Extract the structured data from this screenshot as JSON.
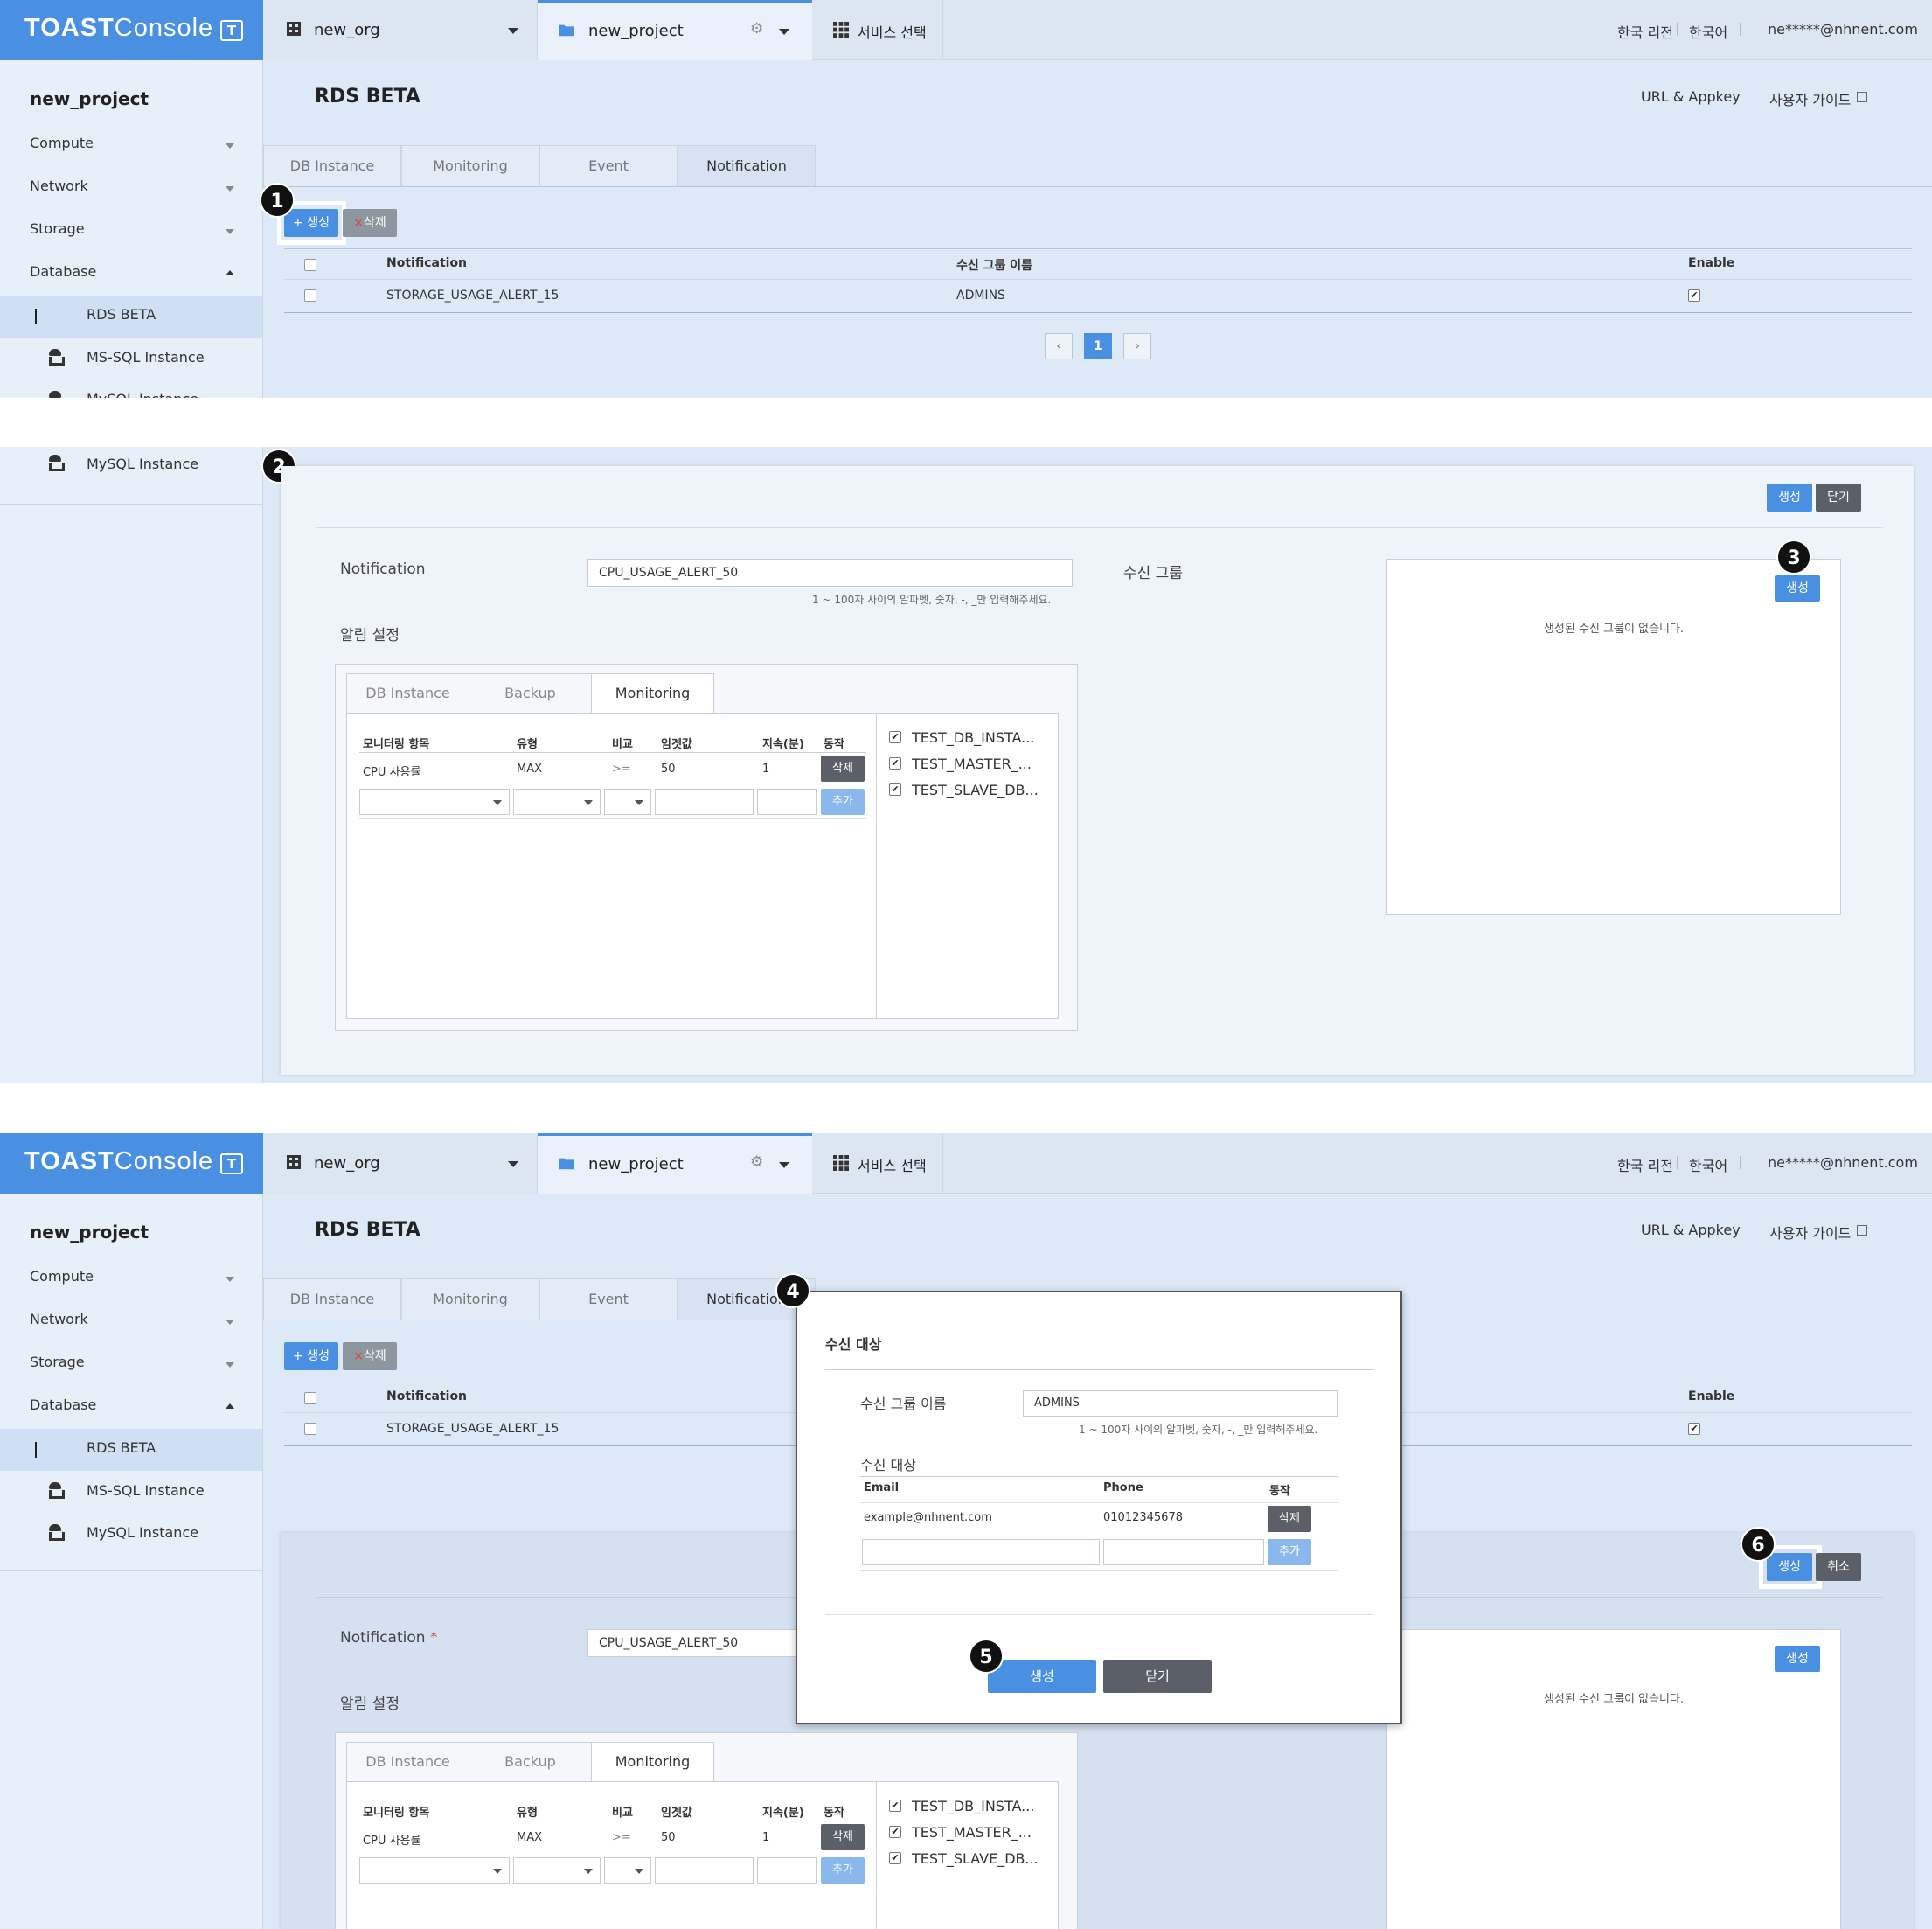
{
  "brand": {
    "name_bold": "TOAST",
    "name_rest": "Console",
    "icon_letter": "T"
  },
  "topbar": {
    "org": "new_org",
    "project": "new_project",
    "service_select": "서비스 선택",
    "region": "한국 리전",
    "language": "한국어",
    "user": "ne*****@nhnent.com"
  },
  "sidebar": {
    "project": "new_project",
    "items": [
      "Compute",
      "Network",
      "Storage",
      "Database"
    ],
    "sub_items": [
      "RDS BETA",
      "MS-SQL Instance",
      "MySQL Instance"
    ]
  },
  "header": {
    "title": "RDS BETA",
    "url_appkey": "URL & Appkey",
    "user_guide": "사용자 가이드"
  },
  "tabs": [
    "DB Instance",
    "Monitoring",
    "Event",
    "Notification"
  ],
  "toolbar": {
    "create": "+ 생성",
    "delete_x": "×",
    "delete": "삭제"
  },
  "notif_table": {
    "headers": [
      "Notification",
      "수신 그룹 이름",
      "Enable"
    ],
    "rows": [
      {
        "notification": "STORAGE_USAGE_ALERT_15",
        "group": "ADMINS",
        "enabled": true
      }
    ]
  },
  "pagination": {
    "prev": "‹",
    "current": "1",
    "next": "›"
  },
  "badges": [
    "1",
    "2",
    "3",
    "4",
    "5",
    "6"
  ],
  "form": {
    "create_btn": "생성",
    "close_btn": "닫기",
    "cancel_btn": "취소",
    "notification_label": "Notification",
    "required_mark": "*",
    "notification_value": "CPU_USAGE_ALERT_50",
    "notification_hint": "1 ~ 100자 사이의 알파벳, 숫자, -, _만 입력해주세요.",
    "recv_group_label": "수신 그룹",
    "recv_group_create": "생성",
    "recv_group_empty": "생성된 수신 그룹이 없습니다.",
    "alarm_settings": "알림 설정",
    "inner_tabs": [
      "DB Instance",
      "Backup",
      "Monitoring"
    ],
    "monitor_headers": [
      "모니터링 항목",
      "유형",
      "비교",
      "임곗값",
      "지속(분)",
      "동작"
    ],
    "monitor_row": {
      "item": "CPU 사용률",
      "type": "MAX",
      "compare": ">=",
      "threshold": "50",
      "duration": "1",
      "action": "삭제"
    },
    "add_btn": "추가",
    "instances": [
      "TEST_DB_INSTA...",
      "TEST_MASTER_...",
      "TEST_SLAVE_DB..."
    ]
  },
  "modal": {
    "title": "수신 대상",
    "group_name_label": "수신 그룹 이름",
    "group_name_value": "ADMINS",
    "hint": "1 ~ 100자 사이의 알파벳, 숫자, -, _만 입력해주세요.",
    "recipients_label": "수신 대상",
    "headers": [
      "Email",
      "Phone",
      "동작"
    ],
    "row": {
      "email": "example@nhnent.com",
      "phone": "01012345678",
      "action": "삭제"
    },
    "add_btn": "추가",
    "create_btn": "생성",
    "close_btn": "닫기"
  },
  "colors": {
    "primary": "#4a90e2",
    "dark_button": "#5b6068",
    "background": "#dde9f7"
  }
}
